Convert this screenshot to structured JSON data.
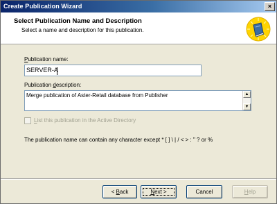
{
  "window": {
    "title": "Create Publication Wizard",
    "close_glyph": "×"
  },
  "header": {
    "title": "Select Publication Name and Description",
    "subtitle": "Select a name and description for this publication.",
    "icon": "wizard-book-icon"
  },
  "form": {
    "name_label_prefix": "",
    "name_label_access": "P",
    "name_label_rest": "ublication name:",
    "name_value": "SERVER-A",
    "desc_label_prefix": "Publication ",
    "desc_label_access": "d",
    "desc_label_rest": "escription:",
    "desc_value": "Merge publication of Aster-Retail database from Publisher",
    "scroll_up": "▲",
    "scroll_down": "▼",
    "checkbox_access": "L",
    "checkbox_label_rest": "ist this publication in the Active Directory",
    "checkbox_checked": false,
    "note": "The publication name can contain any character except * [ ] \\ | / < > : \" ? or %"
  },
  "buttons": {
    "back_prefix": "< ",
    "back_access": "B",
    "back_rest": "ack",
    "next_access": "N",
    "next_rest": "ext >",
    "cancel": "Cancel",
    "help_access": "H",
    "help_rest": "elp"
  },
  "colors": {
    "title_bar_start": "#0a246a",
    "title_bar_end": "#a6caf0",
    "dialog_bg": "#ece9d8",
    "badge_yellow": "#ffd400"
  }
}
